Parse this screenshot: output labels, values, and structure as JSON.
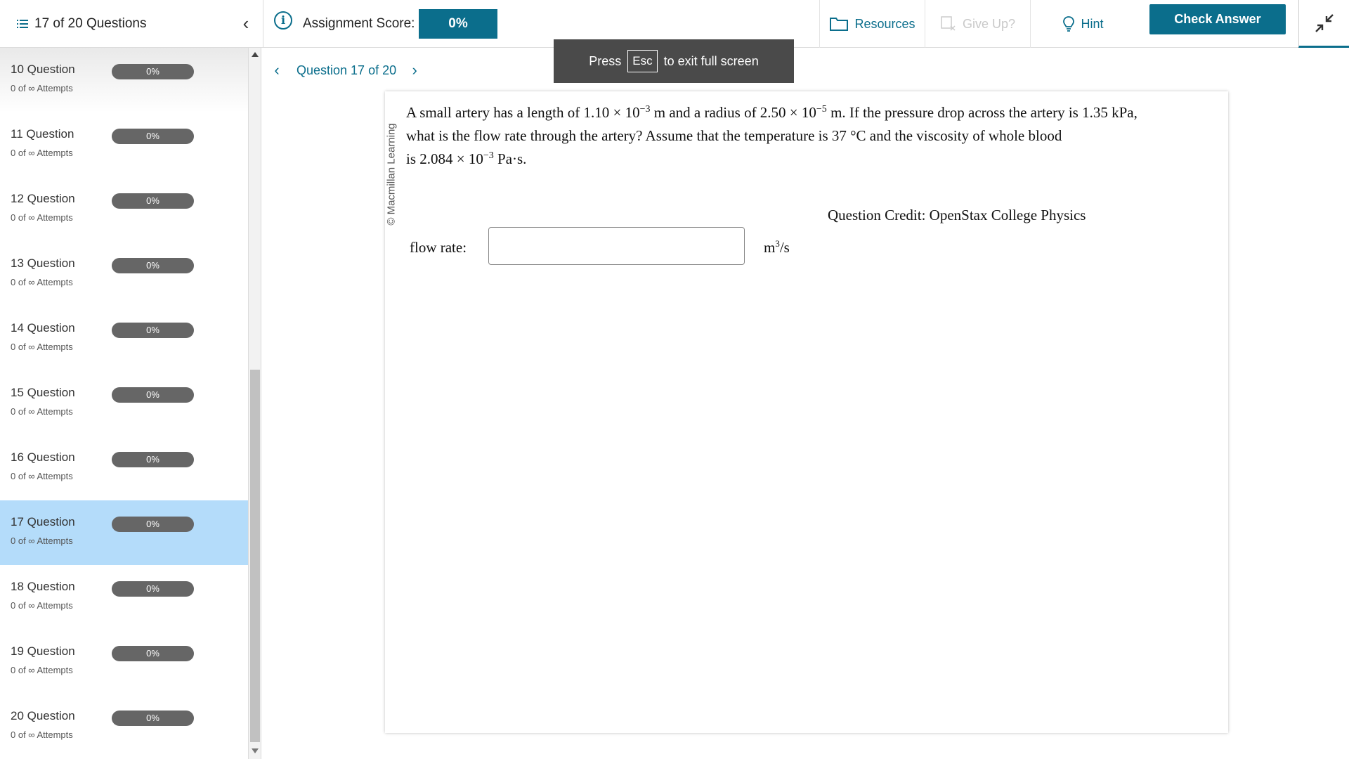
{
  "header": {
    "question_count": "17 of 20 Questions",
    "score_label": "Assignment Score:",
    "score_value": "0%",
    "resources_label": "Resources",
    "giveup_label": "Give Up?",
    "hint_label": "Hint",
    "check_label": "Check Answer"
  },
  "sidebar": {
    "items": [
      {
        "title": "10 Question",
        "attempts": "0 of ∞ Attempts",
        "score": "0%",
        "progress": 0
      },
      {
        "title": "11 Question",
        "attempts": "0 of ∞ Attempts",
        "score": "0%",
        "progress": 0
      },
      {
        "title": "12 Question",
        "attempts": "0 of ∞ Attempts",
        "score": "0%",
        "progress": 0
      },
      {
        "title": "13 Question",
        "attempts": "0 of ∞ Attempts",
        "score": "0%",
        "progress": 0
      },
      {
        "title": "14 Question",
        "attempts": "0 of ∞ Attempts",
        "score": "0%",
        "progress": 0
      },
      {
        "title": "15 Question",
        "attempts": "0 of ∞ Attempts",
        "score": "0%",
        "progress": 0
      },
      {
        "title": "16 Question",
        "attempts": "0 of ∞ Attempts",
        "score": "0%",
        "progress": 0
      },
      {
        "title": "17 Question",
        "attempts": "0 of ∞ Attempts",
        "score": "0%",
        "progress": 0,
        "active": true
      },
      {
        "title": "18 Question",
        "attempts": "0 of ∞ Attempts",
        "score": "0%",
        "progress": 0
      },
      {
        "title": "19 Question",
        "attempts": "0 of ∞ Attempts",
        "score": "0%",
        "progress": 0
      },
      {
        "title": "20 Question",
        "attempts": "0 of ∞ Attempts",
        "score": "0%",
        "progress": 0
      }
    ]
  },
  "nav": {
    "label": "Question 17 of 20"
  },
  "toast": {
    "press": "Press",
    "key": "Esc",
    "rest": "to exit full screen"
  },
  "question": {
    "watermark": "© Macmillan Learning",
    "l1_a": "A small artery has a length of 1.10 × 10",
    "l1_exp1": "−3",
    "l1_b": " m and a radius of 2.50 × 10",
    "l1_exp2": "−5",
    "l1_c": " m. If the pressure drop across the artery is 1.35 kPa,",
    "l2": "what is the flow rate through the artery? Assume that the temperature is 37 °C and the viscosity of whole blood",
    "l3_a": "is 2.084 × 10",
    "l3_exp": "−3",
    "l3_b": " Pa·s.",
    "credit": "Question Credit: OpenStax College Physics",
    "answer_label": "flow rate:",
    "answer_value": "",
    "unit_base": "m",
    "unit_exp": "3",
    "unit_rest": "/s"
  },
  "colors": {
    "accent": "#0b6e8c",
    "active_row": "#b4dcfa",
    "bar": "#666666"
  }
}
